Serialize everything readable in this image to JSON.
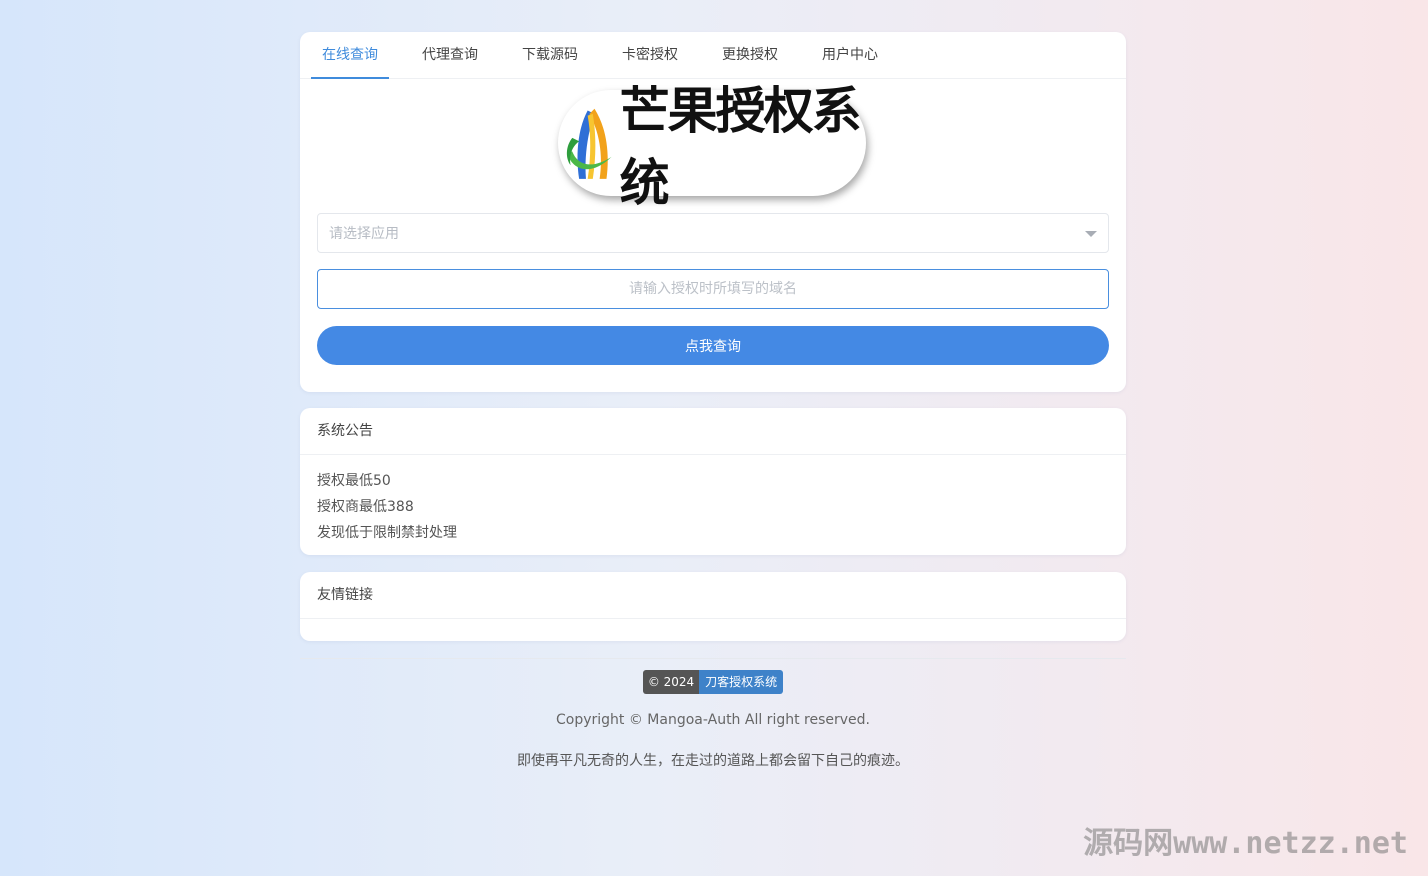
{
  "tabs": [
    {
      "label": "在线查询",
      "active": true
    },
    {
      "label": "代理查询",
      "active": false
    },
    {
      "label": "下载源码",
      "active": false
    },
    {
      "label": "卡密授权",
      "active": false
    },
    {
      "label": "更换授权",
      "active": false
    },
    {
      "label": "用户中心",
      "active": false
    }
  ],
  "logo": {
    "text": "芒果授权系统",
    "icon": "mango-logo-icon"
  },
  "form": {
    "select_placeholder": "请选择应用",
    "domain_placeholder": "请输入授权时所填写的域名",
    "domain_value": "",
    "submit_label": "点我查询"
  },
  "notice": {
    "title": "系统公告",
    "lines": [
      "授权最低50",
      "授权商最低388",
      "发现低于限制禁封处理"
    ]
  },
  "links": {
    "title": "友情链接"
  },
  "footer": {
    "badge_left": "© 2024",
    "badge_right": "刀客授权系统",
    "copyright": "Copyright © Mangoa-Auth All right reserved.",
    "motto": "即使再平凡无奇的人生，在走过的道路上都会留下自己的痕迹。"
  },
  "watermark": "源码网www.netzz.net",
  "colors": {
    "accent": "#4489e4",
    "tab_active": "#3f8bdc",
    "badge_right": "#3e82c9"
  }
}
